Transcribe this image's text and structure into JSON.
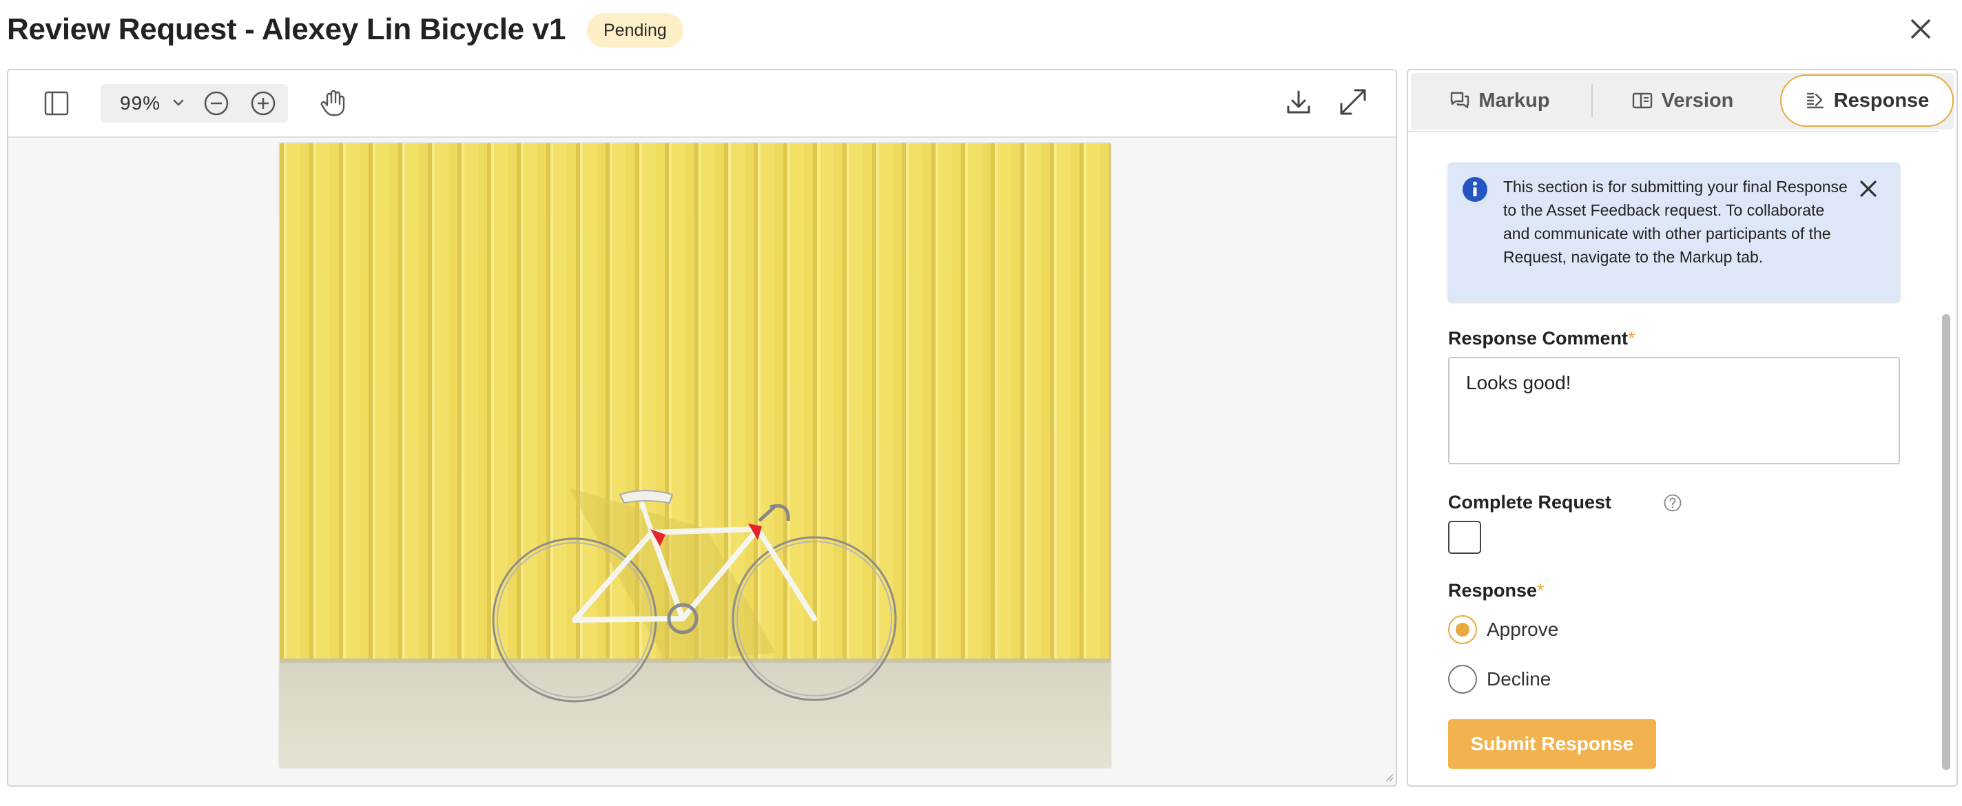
{
  "header": {
    "title": "Review Request - Alexey Lin Bicycle v1",
    "status": "Pending"
  },
  "viewer": {
    "zoom_level": "99%",
    "icons": [
      "sidebar-toggle-icon",
      "chevron-down-icon",
      "zoom-out-icon",
      "zoom-in-icon",
      "hand-pan-icon",
      "download-icon",
      "fullscreen-icon"
    ]
  },
  "tabs": [
    {
      "label": "Markup",
      "icon": "chat-icon"
    },
    {
      "label": "Version",
      "icon": "version-icon"
    },
    {
      "label": "Response",
      "icon": "response-icon",
      "active": true
    }
  ],
  "info": {
    "text": "This section is for submitting your final Response to the Asset Feedback request. To collaborate and communicate with other participants of the Request, navigate to the Markup tab."
  },
  "form": {
    "comment_label": "Response Comment",
    "comment_value": "Looks good!",
    "required_mark": "*",
    "complete_label": "Complete Request",
    "complete_checked": false,
    "response_label": "Response",
    "options": [
      {
        "label": "Approve",
        "checked": true
      },
      {
        "label": "Decline",
        "checked": false
      }
    ],
    "submit_label": "Submit Response"
  },
  "colors": {
    "accent": "#e8a93e",
    "submit": "#f2b24e",
    "badge_bg": "#fdf0c9",
    "info_bg": "#dde7f8",
    "info_icon": "#2356c4"
  }
}
